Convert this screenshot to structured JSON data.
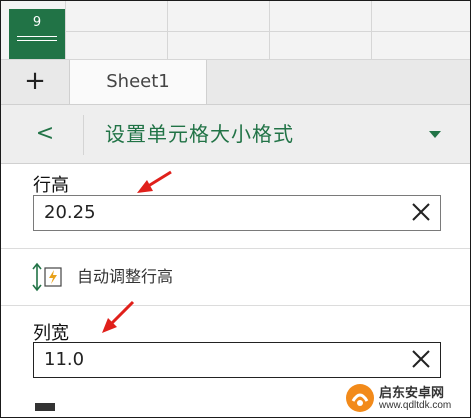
{
  "grid": {
    "selected_cell_value": "9"
  },
  "sheet_tabs": {
    "add_label": "+",
    "tabs": [
      "Sheet1"
    ]
  },
  "panel": {
    "back_label": "<",
    "title": "设置单元格大小格式"
  },
  "row_height": {
    "label": "行高",
    "value": "20.25"
  },
  "autofit": {
    "label": "自动调整行高"
  },
  "column_width": {
    "label": "列宽",
    "value": "11.0"
  },
  "watermark": {
    "name": "启东安卓网",
    "url": "www.qdltdk.com"
  },
  "colors": {
    "accent": "#217346",
    "annotation_arrow": "#e0201b",
    "watermark_orange": "#f28a1a"
  },
  "icons": [
    "close-icon",
    "autofit-row-height-icon",
    "back-chevron-icon",
    "dropdown-triangle-icon",
    "annotation-arrow"
  ]
}
